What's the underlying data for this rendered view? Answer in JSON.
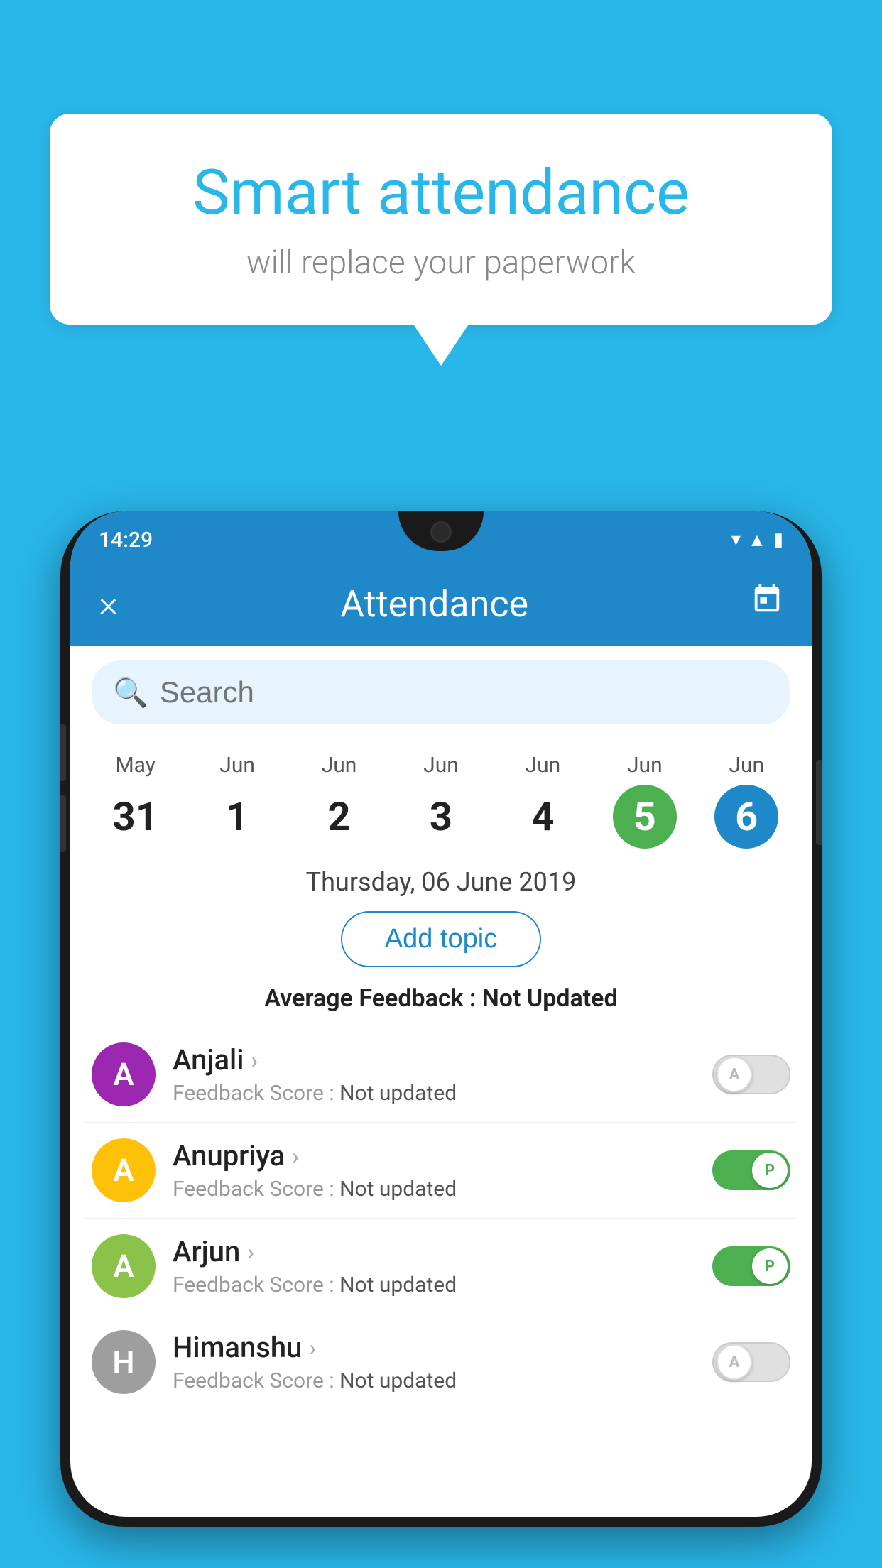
{
  "background_color": "#29b6e8",
  "speech_bubble": {
    "title": "Smart attendance",
    "subtitle": "will replace your paperwork"
  },
  "status_bar": {
    "time": "14:29"
  },
  "app_header": {
    "title": "Attendance",
    "close_label": "×"
  },
  "search": {
    "placeholder": "Search"
  },
  "calendar": {
    "dates": [
      {
        "month": "May",
        "day": "31",
        "style": "normal"
      },
      {
        "month": "Jun",
        "day": "1",
        "style": "normal"
      },
      {
        "month": "Jun",
        "day": "2",
        "style": "normal"
      },
      {
        "month": "Jun",
        "day": "3",
        "style": "normal"
      },
      {
        "month": "Jun",
        "day": "4",
        "style": "normal"
      },
      {
        "month": "Jun",
        "day": "5",
        "style": "today"
      },
      {
        "month": "Jun",
        "day": "6",
        "style": "selected"
      }
    ],
    "selected_date_label": "Thursday, 06 June 2019"
  },
  "add_topic_button_label": "Add topic",
  "average_feedback": {
    "label": "Average Feedback : ",
    "value": "Not Updated"
  },
  "students": [
    {
      "name": "Anjali",
      "avatar_letter": "A",
      "avatar_color": "#9c27b0",
      "feedback_label": "Feedback Score : ",
      "feedback_value": "Not updated",
      "toggle_state": "off",
      "toggle_label": "A"
    },
    {
      "name": "Anupriya",
      "avatar_letter": "A",
      "avatar_color": "#ffc107",
      "feedback_label": "Feedback Score : ",
      "feedback_value": "Not updated",
      "toggle_state": "on",
      "toggle_label": "P"
    },
    {
      "name": "Arjun",
      "avatar_letter": "A",
      "avatar_color": "#8bc34a",
      "feedback_label": "Feedback Score : ",
      "feedback_value": "Not updated",
      "toggle_state": "on",
      "toggle_label": "P"
    },
    {
      "name": "Himanshu",
      "avatar_letter": "H",
      "avatar_color": "#9e9e9e",
      "feedback_label": "Feedback Score : ",
      "feedback_value": "Not updated",
      "toggle_state": "off",
      "toggle_label": "A"
    }
  ]
}
